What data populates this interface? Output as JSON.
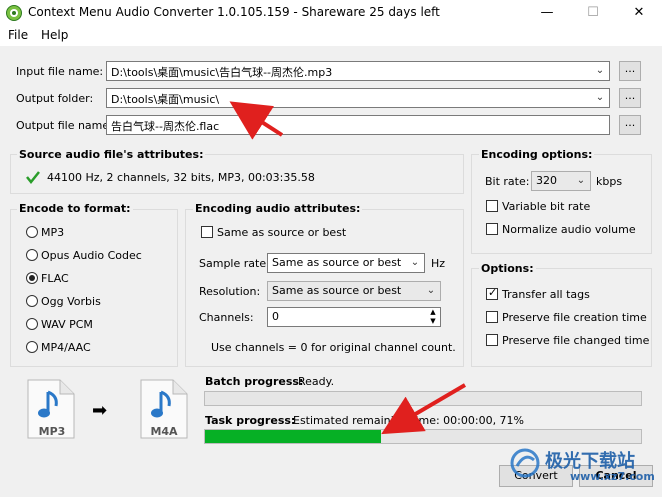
{
  "window": {
    "title": "Context Menu Audio Converter 1.0.105.159 - Shareware 25 days left",
    "minimize_glyph": "—",
    "maximize_glyph": "☐",
    "close_glyph": "✕"
  },
  "menu": {
    "file": "File",
    "help": "Help"
  },
  "files": {
    "input_label": "Input file name:",
    "input_value": "D:\\tools\\桌面\\music\\告白气球--周杰伦.mp3",
    "output_folder_label": "Output folder:",
    "output_folder_value": "D:\\tools\\桌面\\music\\",
    "output_name_label": "Output file name:",
    "output_name_value": "告白气球--周杰伦.flac",
    "browse_label": "..."
  },
  "source": {
    "title": "Source audio file's attributes:",
    "attributes": "44100 Hz, 2 channels, 32 bits, MP3, 00:03:35.58"
  },
  "encode_format": {
    "title": "Encode to format:",
    "options": [
      "MP3",
      "Opus Audio Codec",
      "FLAC",
      "Ogg Vorbis",
      "WAV PCM",
      "MP4/AAC"
    ],
    "selected": "FLAC"
  },
  "encoding_attrs": {
    "title": "Encoding audio attributes:",
    "same_as_source": "Same as source or best",
    "sample_rate_label": "Sample rate:",
    "sample_rate_value": "Same as source or best",
    "sample_rate_unit": "Hz",
    "resolution_label": "Resolution:",
    "resolution_value": "Same as source or best",
    "channels_label": "Channels:",
    "channels_value": "0",
    "channels_hint": "Use channels = 0 for original channel count."
  },
  "encoding_options": {
    "title": "Encoding options:",
    "bitrate_label": "Bit rate:",
    "bitrate_value": "320",
    "bitrate_unit": "kbps",
    "vbr_label": "Variable bit rate",
    "normalize_label": "Normalize audio volume"
  },
  "options": {
    "title": "Options:",
    "transfer_tags": "Transfer all tags",
    "preserve_creation": "Preserve file creation time",
    "preserve_changed": "Preserve file changed time"
  },
  "icons": {
    "from_label": "MP3",
    "to_label": "M4A",
    "arrow": "➡"
  },
  "progress": {
    "batch_label": "Batch progress:",
    "batch_status": "Ready.",
    "task_label": "Task progress:",
    "task_status": "Estimated remaining time: 00:00:00, 71%",
    "task_percent": 71
  },
  "buttons": {
    "convert": "Convert",
    "cancel": "Cancel"
  },
  "watermark": {
    "text": "极光下载站",
    "url": "www.xz7.com"
  },
  "colors": {
    "progress_fill": "#06b025",
    "check_green": "#2a9d2a",
    "annotation_red": "#e0201e",
    "note_blue": "#2a78c8"
  }
}
